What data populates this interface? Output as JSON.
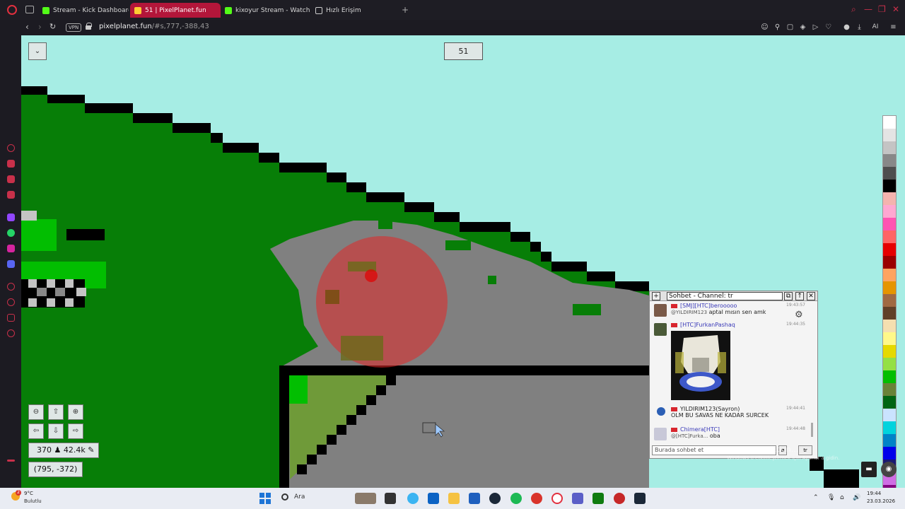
{
  "browser": {
    "tabs": [
      {
        "label": "Stream - Kick Dashboard",
        "favicon_color": "#53fc18"
      },
      {
        "label": "51 | PixelPlanet.fun",
        "favicon_color": "#ffcc33"
      },
      {
        "label": "kixoyur Stream - Watch Li",
        "favicon_color": "#53fc18"
      },
      {
        "label": "Hızlı Erişim",
        "favicon_color": "#cccccc"
      }
    ],
    "vpn_label": "VPN",
    "url_domain": "pixelplanet.fun",
    "url_rest": "/#s,777,-388,43",
    "toolbar_ai": "AI"
  },
  "game": {
    "online_count": "51",
    "user_count": "370",
    "total_pixels": "42.4k",
    "coordinates": "(795, -372)",
    "palette": [
      "#ffffff",
      "#e4e4e4",
      "#c4c4c4",
      "#888888",
      "#4e4e4e",
      "#000000",
      "#f4b3ae",
      "#ffa7d1",
      "#ff54b2",
      "#ff6565",
      "#e50000",
      "#9a0000",
      "#fea460",
      "#e59500",
      "#a06a42",
      "#604028",
      "#f5dfb0",
      "#fff889",
      "#e5d900",
      "#94e044",
      "#02be01",
      "#688338",
      "#006513",
      "#cae3ff",
      "#00d3dd",
      "#0083c7",
      "#0000ea",
      "#191973",
      "#cf6ee4",
      "#820080"
    ]
  },
  "chat": {
    "title": "Sohbet - Channel: tr",
    "messages": [
      {
        "name": "[SMJ][HTC]berooooo",
        "quote": "@YILDIRIM123",
        "text": "aptal mısın sen amk",
        "time": "19:43:57",
        "avatar_color": "#7a5a48"
      },
      {
        "name": "[HTC]FurkanPashaq",
        "quote": "",
        "text": "",
        "time": "19:44:35",
        "avatar_color": "#4a5a38"
      },
      {
        "name": "YILDIRIM123(Sayron)",
        "quote": "",
        "text": "OLM BU SAVAS NE KADAR SURCEK",
        "time": "19:44:41",
        "avatar_color": "#2b5fb5"
      },
      {
        "name": "Chimera[HTC]",
        "quote": "@[HTC]Furka...",
        "text": "oba",
        "time": "19:44:48",
        "avatar_color": "#c8c8d8"
      }
    ],
    "input_placeholder": "Burada sohbet et",
    "channel_short": "tr",
    "watermark_line1": "Windows u Etkin...",
    "watermark_line2": "Windows u etkinleştirmek için Ayarlar'a gidin."
  },
  "taskbar": {
    "weather_temp": "9°C",
    "weather_desc": "Bulutlu",
    "weather_badge": "2",
    "search_label": "Ara",
    "time": "19:44",
    "date": "23.03.2026"
  }
}
